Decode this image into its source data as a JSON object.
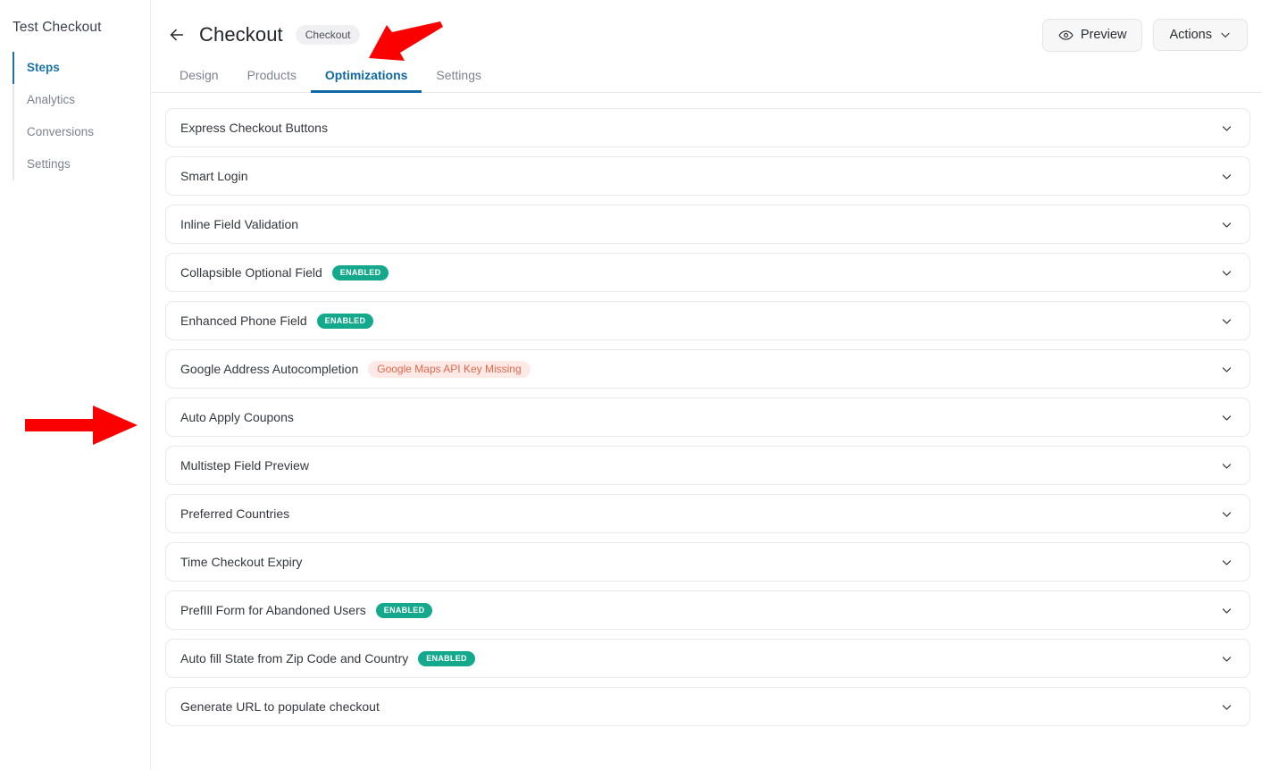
{
  "sidebar": {
    "title": "Test Checkout",
    "items": [
      {
        "label": "Steps",
        "active": true
      },
      {
        "label": "Analytics",
        "active": false
      },
      {
        "label": "Conversions",
        "active": false
      },
      {
        "label": "Settings",
        "active": false
      }
    ]
  },
  "header": {
    "back_icon": "arrow-left-icon",
    "title": "Checkout",
    "pill": "Checkout",
    "preview_label": "Preview",
    "preview_icon": "eye-icon",
    "actions_label": "Actions",
    "actions_icon": "chevron-down-icon"
  },
  "tabs": [
    {
      "label": "Design",
      "active": false
    },
    {
      "label": "Products",
      "active": false
    },
    {
      "label": "Optimizations",
      "active": true
    },
    {
      "label": "Settings",
      "active": false
    }
  ],
  "optimizations": [
    {
      "label": "Express Checkout Buttons",
      "badge": null,
      "badge_type": null
    },
    {
      "label": "Smart Login",
      "badge": null,
      "badge_type": null
    },
    {
      "label": "Inline Field Validation",
      "badge": null,
      "badge_type": null
    },
    {
      "label": "Collapsible Optional Field",
      "badge": "ENABLED",
      "badge_type": "enabled"
    },
    {
      "label": "Enhanced Phone Field",
      "badge": "ENABLED",
      "badge_type": "enabled"
    },
    {
      "label": "Google Address Autocompletion",
      "badge": "Google Maps API Key Missing",
      "badge_type": "warn"
    },
    {
      "label": "Auto Apply Coupons",
      "badge": null,
      "badge_type": null
    },
    {
      "label": "Multistep Field Preview",
      "badge": null,
      "badge_type": null
    },
    {
      "label": "Preferred Countries",
      "badge": null,
      "badge_type": null
    },
    {
      "label": "Time Checkout Expiry",
      "badge": null,
      "badge_type": null
    },
    {
      "label": "PrefIll Form for Abandoned Users",
      "badge": "ENABLED",
      "badge_type": "enabled"
    },
    {
      "label": "Auto fill State from Zip Code and Country",
      "badge": "ENABLED",
      "badge_type": "enabled"
    },
    {
      "label": "Generate URL to populate checkout",
      "badge": null,
      "badge_type": null
    }
  ],
  "annotations": [
    {
      "name": "arrow-pointing-to-optimizations-tab",
      "color": "#fa0000",
      "direction": "down-left"
    },
    {
      "name": "arrow-pointing-to-auto-apply-coupons-row",
      "color": "#fa0000",
      "direction": "right"
    }
  ],
  "colors": {
    "accent_blue": "#1069a4",
    "enabled_teal": "#14a98c",
    "warn_text": "#e4674b",
    "warn_bg": "#fde9e5",
    "annotation_red": "#fa0000"
  }
}
